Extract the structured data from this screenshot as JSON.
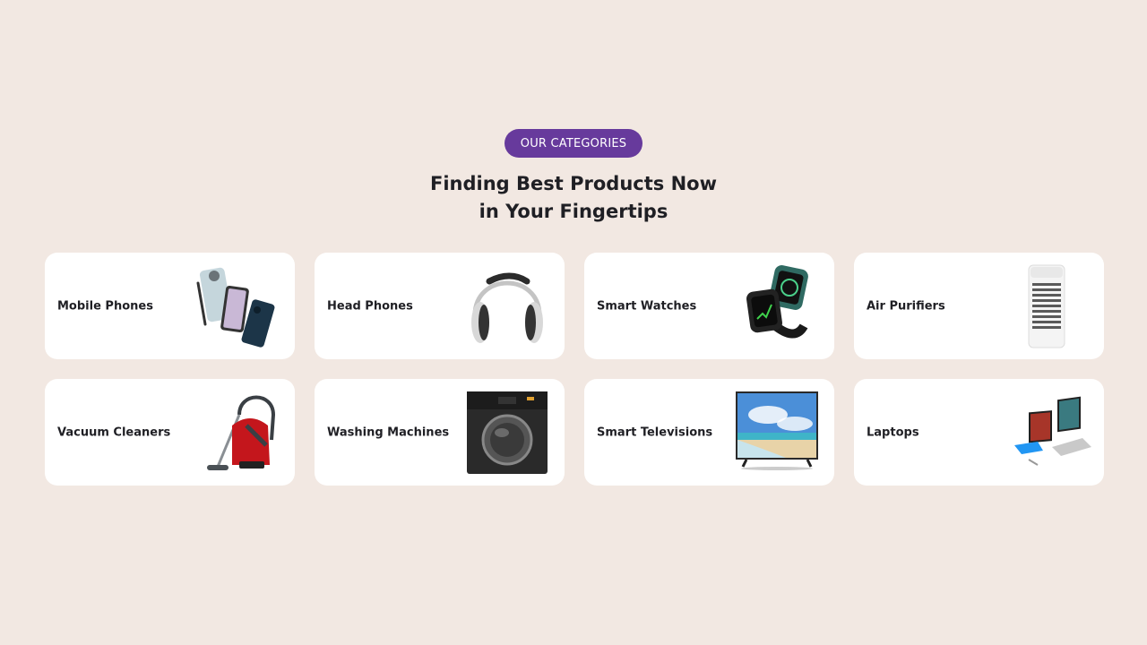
{
  "section": {
    "badge": "OUR CATEGORIES",
    "heading_line1": "Finding Best Products Now",
    "heading_line2": "in Your Fingertips",
    "accent_color": "#673a9c",
    "background_color": "#f2e8e2"
  },
  "categories": [
    {
      "label": "Mobile Phones",
      "icon": "mobile-phones-image"
    },
    {
      "label": "Head Phones",
      "icon": "headphones-image"
    },
    {
      "label": "Smart Watches",
      "icon": "smart-watches-image"
    },
    {
      "label": "Air Purifiers",
      "icon": "air-purifier-image"
    },
    {
      "label": "Vacuum Cleaners",
      "icon": "vacuum-cleaner-image"
    },
    {
      "label": "Washing Machines",
      "icon": "washing-machine-image"
    },
    {
      "label": "Smart Televisions",
      "icon": "smart-tv-image"
    },
    {
      "label": "Laptops",
      "icon": "laptops-image"
    }
  ]
}
